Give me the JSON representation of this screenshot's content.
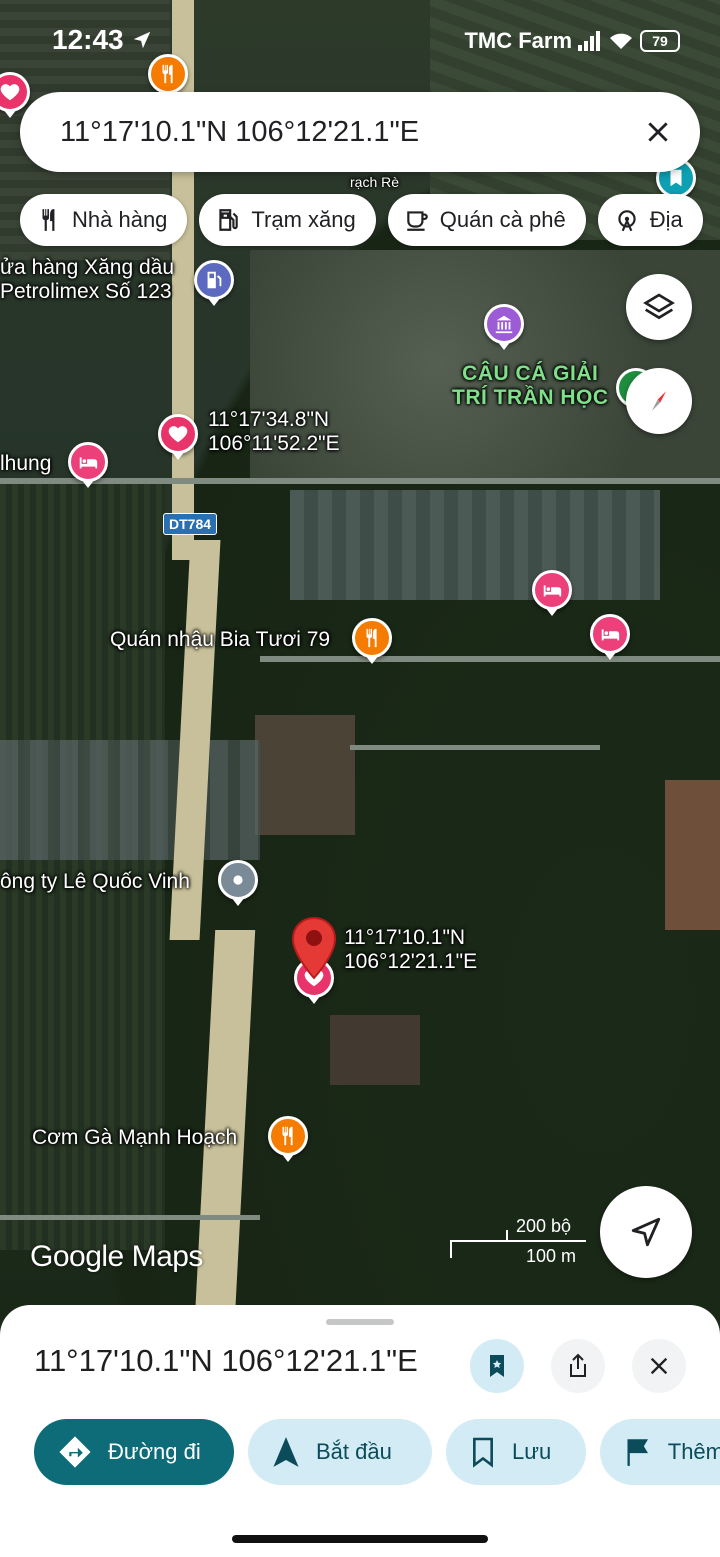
{
  "status_bar": {
    "time": "12:43",
    "carrier": "TMC Farm",
    "battery": "79"
  },
  "search": {
    "query": "11°17'10.1\"N 106°12'21.1\"E"
  },
  "chips": [
    {
      "label": "Nhà hàng",
      "icon": "fork-knife-icon"
    },
    {
      "label": "Trạm xăng",
      "icon": "gas-station-icon"
    },
    {
      "label": "Quán cà phê",
      "icon": "coffee-cup-icon"
    },
    {
      "label": "Địa",
      "icon": "attraction-icon"
    }
  ],
  "map": {
    "labels": {
      "rach_re": "rạch Rè",
      "petrol_line1": "ửa hàng Xăng dầu",
      "petrol_line2": "Petrolimex Số 123",
      "fishing_line1": "CÂU CÁ GIẢI",
      "fishing_line2": "TRÍ TRẦN HỌC",
      "saved_coord_line1": "11°17'34.8\"N",
      "saved_coord_line2": "106°11'52.2\"E",
      "nhung": "lhung",
      "road": "DT784",
      "quan_nhau": "Quán nhậu Bia Tươi 79",
      "company": "ông ty Lê Quốc Vinh",
      "dropped_pin_line1": "11°17'10.1\"N",
      "dropped_pin_line2": "106°12'21.1\"E",
      "com_ga": "Cơm Gà Mạnh Hoạch"
    },
    "brand": "Google Maps",
    "scale": {
      "imperial": "200 bộ",
      "metric": "100 m"
    },
    "colors": {
      "restaurant": "#f57c00",
      "hotel": "#ec407a",
      "saved": "#e8336b",
      "gas": "#5c6bc0",
      "attraction": "#9c5cd6",
      "pin": "#e53935"
    }
  },
  "sheet": {
    "title": "11°17'10.1\"N 106°12'21.1\"E",
    "actions": {
      "directions": "Đường đi",
      "start": "Bắt đầu",
      "save": "Lưu",
      "more": "Thêm"
    }
  }
}
